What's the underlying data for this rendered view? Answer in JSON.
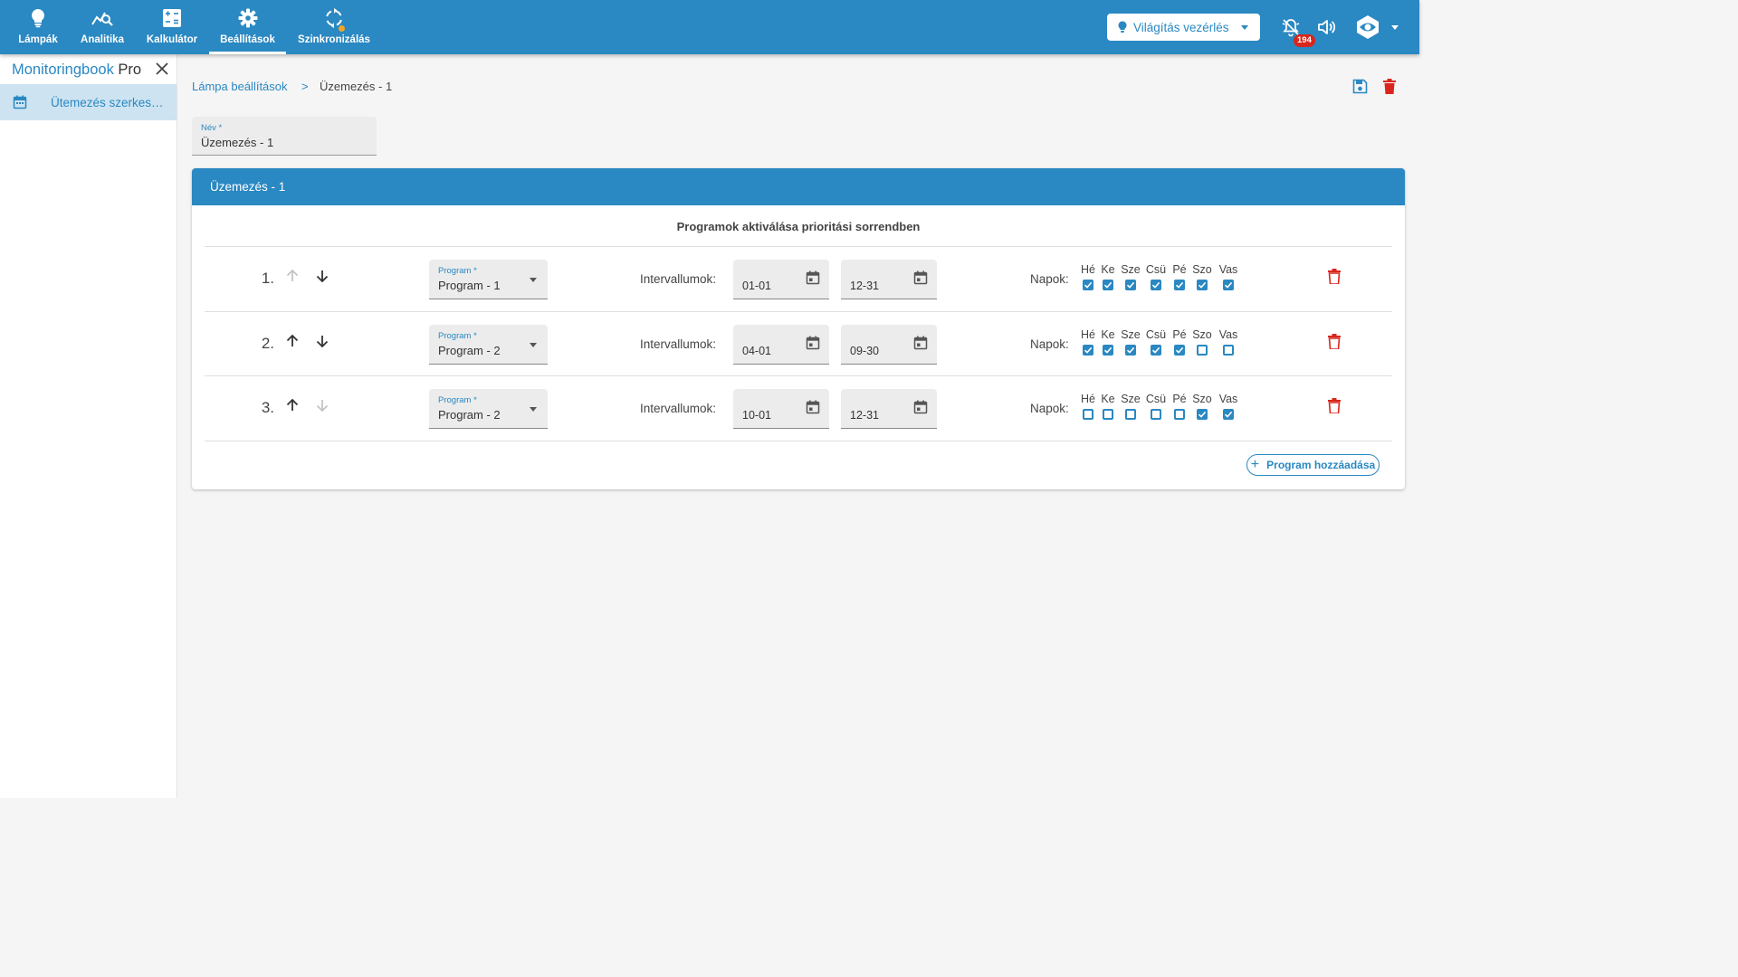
{
  "nav": {
    "items": [
      {
        "label": "Lámpák",
        "icon": "lightbulb-icon"
      },
      {
        "label": "Analitika",
        "icon": "analytics-icon"
      },
      {
        "label": "Kalkulátor",
        "icon": "calculator-icon"
      },
      {
        "label": "Beállítások",
        "icon": "gear-icon",
        "active": true
      },
      {
        "label": "Szinkronizálás",
        "icon": "sync-icon"
      }
    ],
    "selector_label": "Világítás vezérlés",
    "notification_count": "194"
  },
  "sidebar": {
    "brand": "Monitoringbook",
    "brand_suffix": "Pro",
    "item_label": "Ütemezés szerkesztése"
  },
  "breadcrumb": {
    "parent": "Lámpa beállítások",
    "separator": ">",
    "current": "Üzemezés - 1"
  },
  "form": {
    "name_label": "Név *",
    "name_value": "Üzemezés - 1"
  },
  "card": {
    "title": "Üzemezés - 1",
    "subtitle": "Programok aktiválása prioritási sorrendben",
    "interval_label": "Intervallumok:",
    "days_label": "Napok:",
    "program_label": "Program *",
    "day_names": [
      "Hé",
      "Ke",
      "Sze",
      "Csü",
      "Pé",
      "Szo",
      "Vas"
    ],
    "rows": [
      {
        "num": "1.",
        "up_enabled": false,
        "down_enabled": true,
        "program": "Program - 1",
        "from": "01-01",
        "to": "12-31",
        "days": [
          true,
          true,
          true,
          true,
          true,
          true,
          true
        ]
      },
      {
        "num": "2.",
        "up_enabled": true,
        "down_enabled": true,
        "program": "Program - 2",
        "from": "04-01",
        "to": "09-30",
        "days": [
          true,
          true,
          true,
          true,
          true,
          false,
          false
        ]
      },
      {
        "num": "3.",
        "up_enabled": true,
        "down_enabled": false,
        "program": "Program - 2",
        "from": "10-01",
        "to": "12-31",
        "days": [
          false,
          false,
          false,
          false,
          false,
          true,
          true
        ]
      }
    ],
    "add_button": "Program hozzáadása"
  },
  "colors": {
    "primary": "#2a88c2",
    "danger": "#d9261c",
    "badge": "#d9261c",
    "sync_dot": "#f5a623"
  }
}
